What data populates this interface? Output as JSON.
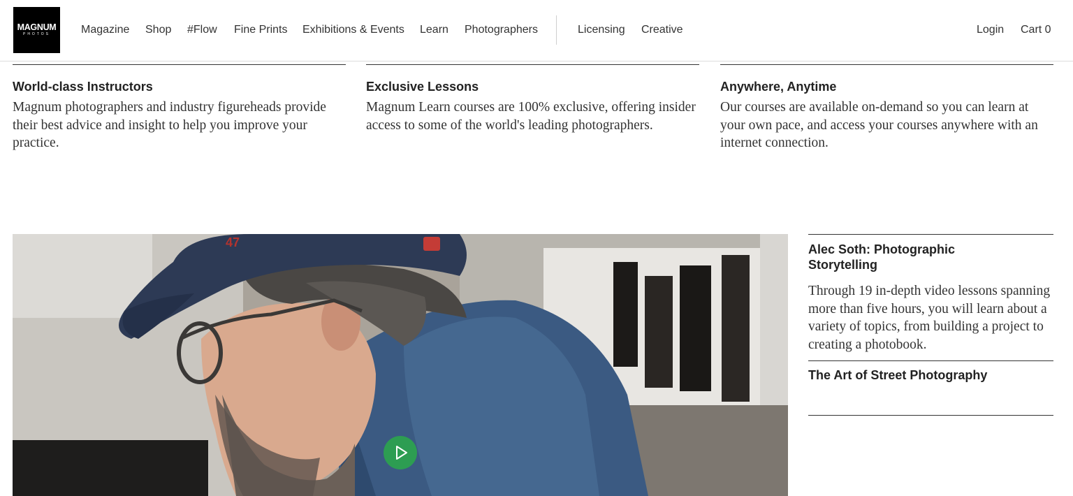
{
  "header": {
    "logo_text": "MAGNUM",
    "logo_subtext": "PHOTOS",
    "nav": [
      "Magazine",
      "Shop",
      "#Flow",
      "Fine Prints",
      "Exhibitions & Events",
      "Learn",
      "Photographers"
    ],
    "nav_secondary": [
      "Licensing",
      "Creative"
    ],
    "login": "Login",
    "cart": "Cart 0"
  },
  "features": [
    {
      "title": "World-class Instructors",
      "text": "Magnum photographers and industry figureheads provide their best advice and insight to help you improve your practice."
    },
    {
      "title": "Exclusive Lessons",
      "text": "Magnum Learn courses are 100% exclusive, offering insider access to some of the world's leading photographers."
    },
    {
      "title": "Anywhere, Anytime",
      "text": "Our courses are available on-demand so you can learn at your own pace, and access your courses anywhere with an internet connection."
    }
  ],
  "video": {
    "play_icon": "play-icon",
    "cap_text": "47",
    "accent_color": "#2d9d52"
  },
  "courses": [
    {
      "title": "Alec Soth: Photographic Storytelling",
      "description": "Through 19 in-depth video lessons spanning more than five hours, you will learn about a variety of topics, from building a project to creating a photobook."
    },
    {
      "title": "The Art of Street Photography"
    }
  ]
}
